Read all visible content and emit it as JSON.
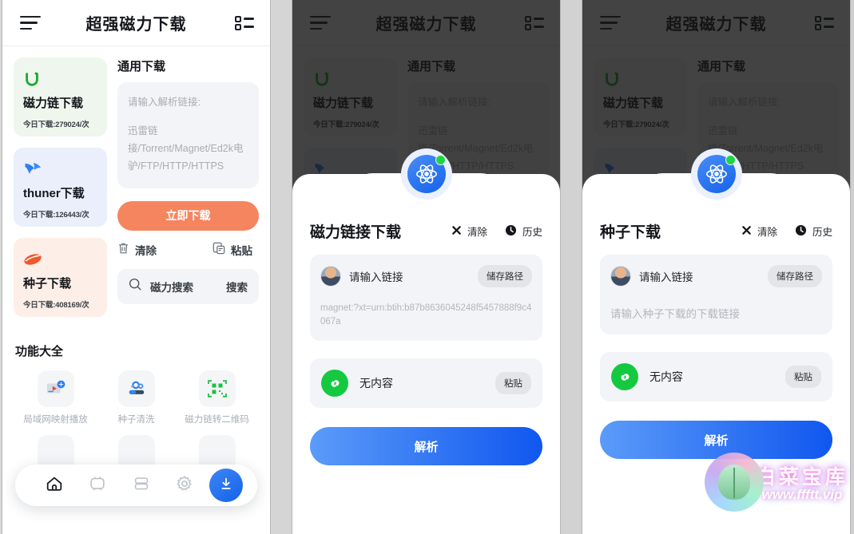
{
  "app": {
    "title": "超强磁力下载",
    "menu_icon": "hamburger-icon",
    "grid_icon": "grid-menu-icon"
  },
  "home": {
    "download_cards": [
      {
        "name": "磁力链下载",
        "count": "今日下载:279024/次",
        "icon": "magnet-icon",
        "tint": "green"
      },
      {
        "name": "thuner下载",
        "count": "今日下载:126443/次",
        "icon": "thunder-bird-icon",
        "tint": "blue"
      },
      {
        "name": "种子下载",
        "count": "今日下载:408169/次",
        "icon": "seed-icon",
        "tint": "pink"
      }
    ],
    "general": {
      "section_title": "通用下载",
      "input_placeholder_line1": "请输入解析链接:",
      "input_placeholder_line2": "迅雷链接/Torrent/Magnet/Ed2k电驴/FTP/HTTP/HTTPS",
      "download_now": "立即下载",
      "clear": "清除",
      "paste": "粘贴",
      "search_placeholder": "磁力搜索",
      "search_button": "搜索"
    },
    "features": {
      "title": "功能大全",
      "items": [
        {
          "label": "局域网映射播放",
          "icon": "lan-cast-icon"
        },
        {
          "label": "种子清洗",
          "icon": "torrent-clean-icon"
        },
        {
          "label": "磁力链转二维码",
          "icon": "qr-code-icon"
        }
      ]
    },
    "bottom_nav": {
      "items": [
        {
          "icon": "home-icon",
          "active": true
        },
        {
          "icon": "tv-icon",
          "active": false
        },
        {
          "icon": "card-stack-icon",
          "active": false
        },
        {
          "icon": "gear-icon",
          "active": false
        }
      ],
      "fab": {
        "icon": "download-icon"
      }
    }
  },
  "sheet_magnet": {
    "logo_icon": "atom-icon",
    "status_dot": "online-dot",
    "title": "磁力链接下载",
    "clear_label": "清除",
    "clear_icon": "close-x-icon",
    "history_label": "历史",
    "history_icon": "clock-icon",
    "input_hint": "请输入链接",
    "avatar_icon": "user-avatar",
    "path_button": "储存路径",
    "value_text": "magnet:?xt=urn:btih:b87b8636045248f5457888f9c4067a",
    "clipboard_icon": "link-icon",
    "clipboard_label": "无内容",
    "paste_button": "粘贴",
    "parse_button": "解析"
  },
  "sheet_torrent": {
    "logo_icon": "atom-icon",
    "status_dot": "online-dot",
    "title": "种子下载",
    "clear_label": "清除",
    "clear_icon": "close-x-icon",
    "history_label": "历史",
    "history_icon": "clock-icon",
    "input_hint": "请输入链接",
    "avatar_icon": "user-avatar",
    "path_button": "储存路径",
    "value_text": "请输入种子下载的下载链接",
    "clipboard_icon": "link-icon",
    "clipboard_label": "无内容",
    "paste_button": "粘贴",
    "parse_button": "解析"
  },
  "watermark": {
    "main": "白菜宝库",
    "sub": "www.ffftt.vip",
    "logo_icon": "cabbage-logo-icon"
  },
  "colors": {
    "accent_blue": "#1462e8",
    "accent_orange": "#f5855f",
    "accent_green": "#14c940",
    "highlight_green": "#43e04a"
  }
}
